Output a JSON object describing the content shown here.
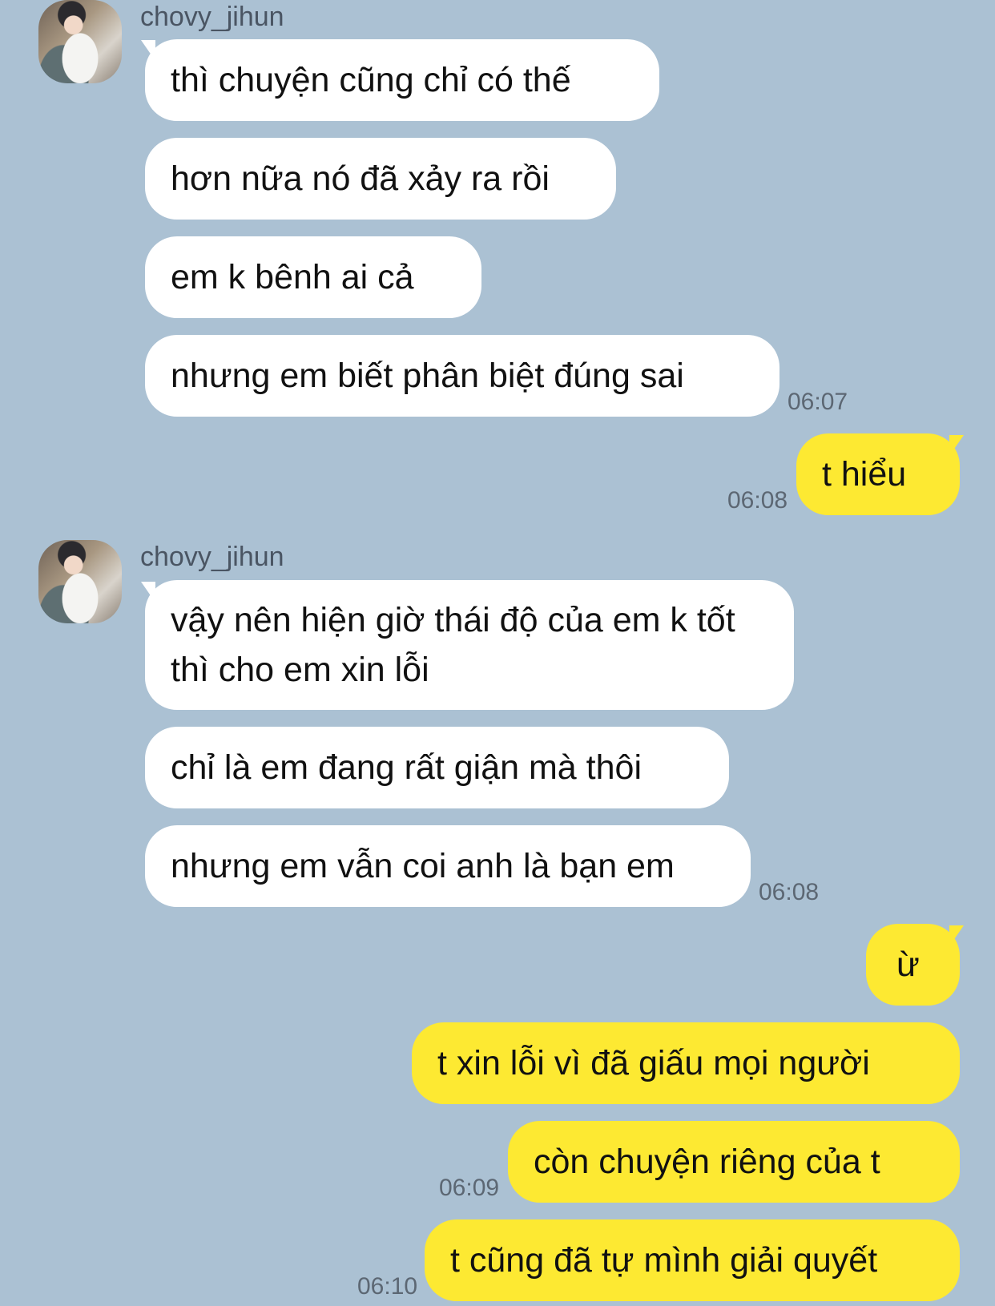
{
  "chat": {
    "group1": {
      "sender": "chovy_jihun",
      "messages": [
        "thì chuyện cũng chỉ có thế",
        "hơn nữa nó đã xảy ra rồi",
        "em k bênh ai cả",
        "nhưng em biết phân biệt đúng sai"
      ],
      "time": "06:07"
    },
    "reply1": {
      "text": "t hiểu",
      "time": "06:08"
    },
    "group2": {
      "sender": "chovy_jihun",
      "messages": [
        "vậy nên hiện giờ thái độ của em k tốt thì cho em xin lỗi",
        "chỉ là em đang rất giận mà thôi",
        "nhưng em vẫn coi anh là bạn em"
      ],
      "time": "06:08"
    },
    "reply2": {
      "messages": [
        "ừ",
        "t xin lỗi vì đã giấu mọi người",
        "còn chuyện riêng của t",
        "t cũng đã tự mình giải quyết"
      ],
      "time_a": "06:09",
      "time_b": "06:10"
    }
  },
  "colors": {
    "background": "#abc1d3",
    "incoming_bubble": "#ffffff",
    "outgoing_bubble": "#fde932"
  }
}
